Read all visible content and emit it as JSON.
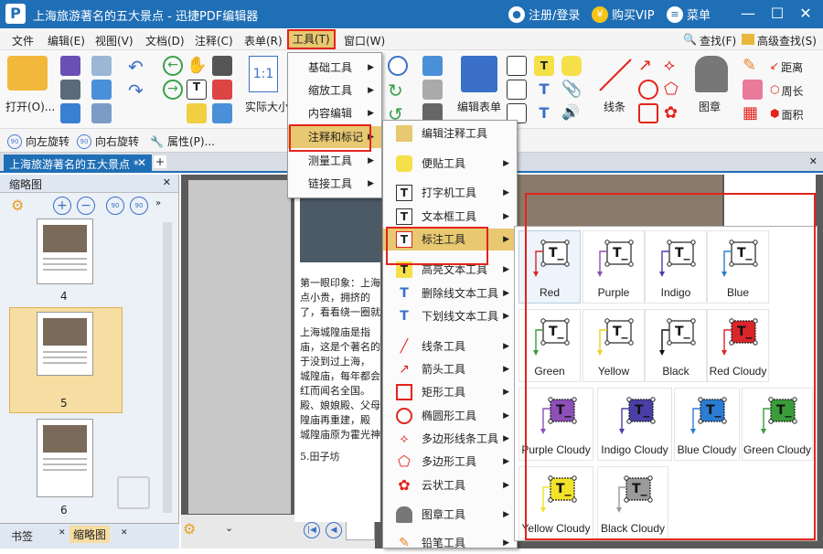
{
  "titlebar": {
    "title": "上海旅游著名的五大景点 - 迅捷PDF编辑器",
    "login": "注册/登录",
    "vip": "购买VIP",
    "menu": "菜单"
  },
  "menubar": {
    "items": [
      "文件",
      "编辑(E)",
      "视图(V)",
      "文档(D)",
      "注释(C)",
      "表单(R)",
      "工具(T)",
      "窗口(W)"
    ]
  },
  "ribbon": {
    "open": "打开(O)...",
    "actual_size": "实际大小",
    "edit_form": "编辑表单",
    "line": "线条",
    "stamp": "图章",
    "find": "查找(F)",
    "adv_find": "高级查找(S)",
    "distance": "距离",
    "perimeter": "周长",
    "area": "面积"
  },
  "toolbar2": {
    "rotate_left": "向左旋转",
    "rotate_right": "向右旋转",
    "properties": "属性(P)..."
  },
  "doctab": {
    "label": "上海旅游著名的五大景点 *"
  },
  "sidepanel": {
    "title": "缩略图",
    "pages": [
      "4",
      "5",
      "6"
    ],
    "tab_bookmarks": "书签",
    "tab_thumbnails": "缩略图"
  },
  "doc": {
    "lines": [
      "第一眼印象：上海",
      "点小贵，拥挤的",
      "了，看看绕一圈就",
      "上海城隍庙是指",
      "庙，这是个著名的",
      "于没到过上海，",
      "城隍庙，每年都会",
      "红而闻名全国。",
      "殿、娘娘殿、父母",
      "隍庙再重建，殿",
      "城隍庙原为霍光神",
      "5.田子坊"
    ]
  },
  "tools_menu": {
    "items": [
      "基础工具",
      "缩放工具",
      "内容编辑",
      "注释和标记",
      "测量工具",
      "链接工具"
    ]
  },
  "annot_menu": {
    "items": [
      "编辑注释工具",
      "便贴工具",
      "打字机工具",
      "文本框工具",
      "标注工具",
      "高亮文本工具",
      "删除线文本工具",
      "下划线文本工具",
      "线条工具",
      "箭头工具",
      "矩形工具",
      "椭圆形工具",
      "多边形线条工具",
      "多边形工具",
      "云状工具",
      "图章工具",
      "铅笔工具"
    ]
  },
  "callout": {
    "items": [
      {
        "label": "Red",
        "color": "#d9262b",
        "cloudy": false
      },
      {
        "label": "Purple",
        "color": "#8d4fb8",
        "cloudy": false
      },
      {
        "label": "Indigo",
        "color": "#4a3fa8",
        "cloudy": false
      },
      {
        "label": "Blue",
        "color": "#2b7cd3",
        "cloudy": false
      },
      {
        "label": "Green",
        "color": "#3a9c3a",
        "cloudy": false
      },
      {
        "label": "Yellow",
        "color": "#e8d21e",
        "cloudy": false
      },
      {
        "label": "Black",
        "color": "#111111",
        "cloudy": false
      },
      {
        "label": "Red Cloudy",
        "color": "#d9262b",
        "cloudy": true
      },
      {
        "label": "Purple Cloudy",
        "color": "#8d4fb8",
        "cloudy": true
      },
      {
        "label": "Indigo Cloudy",
        "color": "#4a3fa8",
        "cloudy": true
      },
      {
        "label": "Blue Cloudy",
        "color": "#2b7cd3",
        "cloudy": true
      },
      {
        "label": "Green Cloudy",
        "color": "#3a9c3a",
        "cloudy": true
      },
      {
        "label": "Yellow Cloudy",
        "color": "#f3e22a",
        "cloudy": true
      },
      {
        "label": "Black Cloudy",
        "color": "#9a9a9a",
        "cloudy": true
      }
    ]
  },
  "colors": {
    "brand": "#1f6fb6",
    "highlight": "#e8c870",
    "red_outline": "#e2241b"
  }
}
